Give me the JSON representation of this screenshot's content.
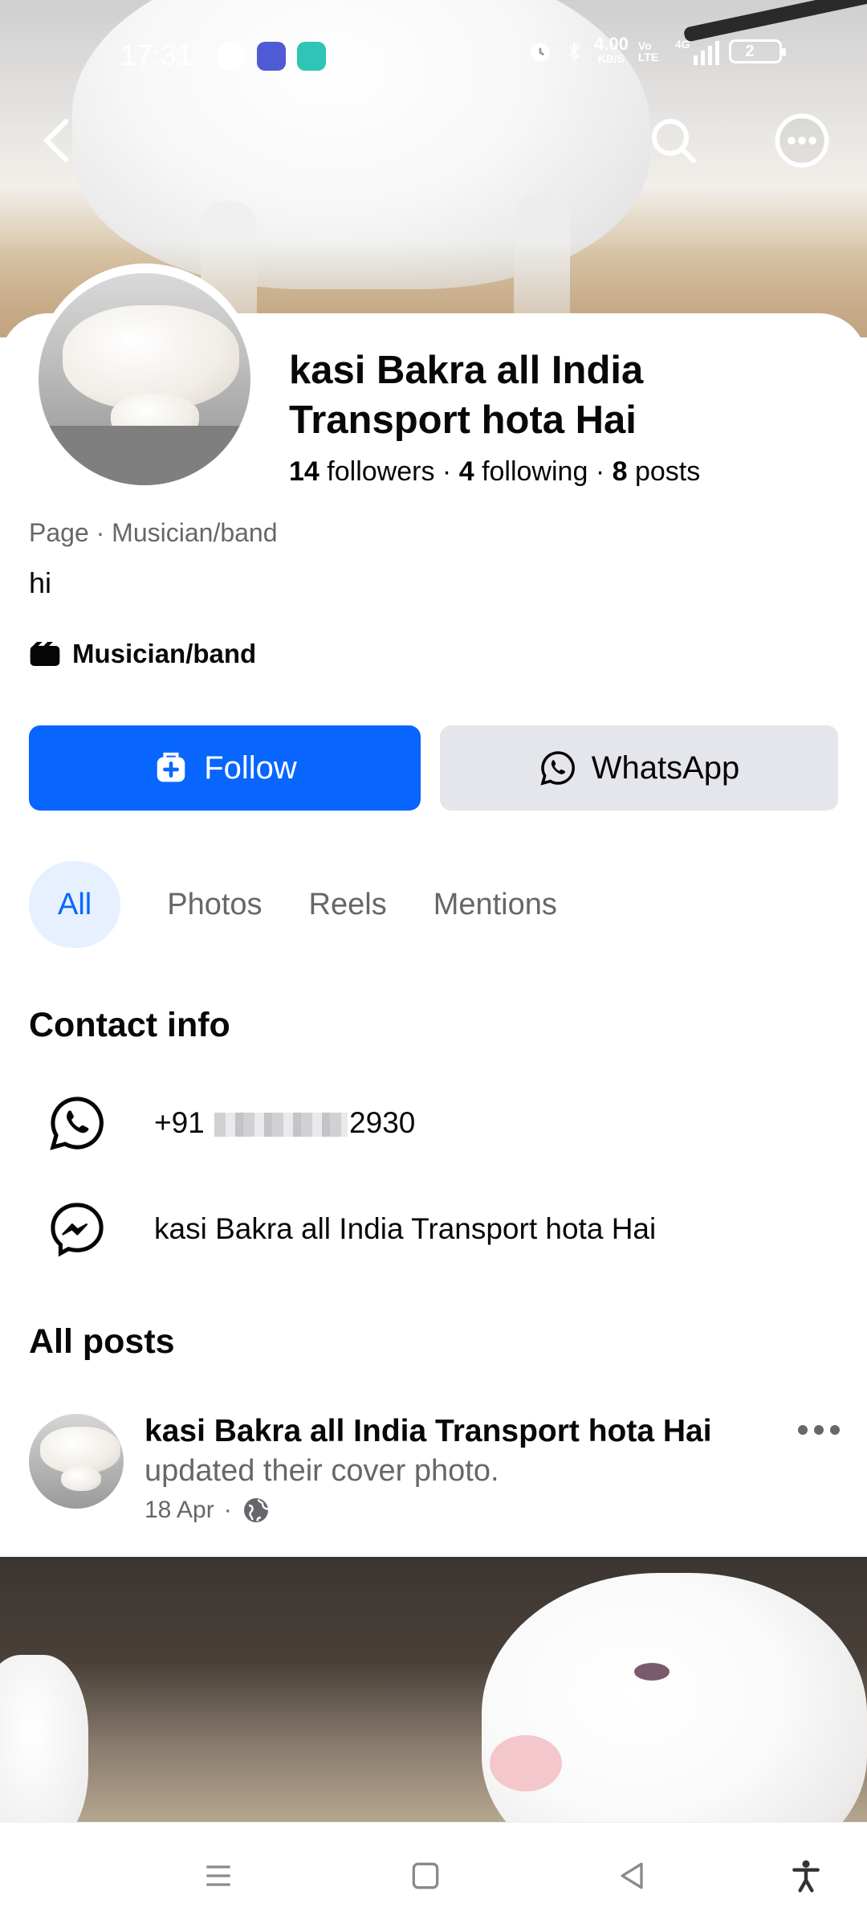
{
  "status_bar": {
    "time": "17:31",
    "network_speed": "4.00",
    "network_unit": "KB/S",
    "volte": "Vo LTE",
    "signal": "4G",
    "battery": "2"
  },
  "profile": {
    "name": "kasi Bakra all India Transport hota Hai",
    "followers_count": "14",
    "followers_label": "followers",
    "following_count": "4",
    "following_label": "following",
    "posts_count": "8",
    "posts_label": "posts",
    "page_category_line": "Page · Musician/band",
    "bio": "hi",
    "category": "Musician/band"
  },
  "actions": {
    "follow_label": "Follow",
    "whatsapp_label": "WhatsApp"
  },
  "tabs": [
    {
      "label": "All"
    },
    {
      "label": "Photos"
    },
    {
      "label": "Reels"
    },
    {
      "label": "Mentions"
    }
  ],
  "contact": {
    "heading": "Contact info",
    "phone_prefix": "+91",
    "phone_suffix": "2930",
    "messenger": "kasi Bakra all India Transport hota Hai"
  },
  "posts": {
    "heading": "All posts",
    "items": [
      {
        "author": "kasi Bakra all India Transport hota Hai",
        "action": "updated their cover photo.",
        "date": "18 Apr",
        "separator": "·"
      }
    ]
  },
  "colors": {
    "accent": "#0866ff",
    "secondary_button": "#e4e6eb",
    "muted_text": "#65676b",
    "active_tab_bg": "#e7f0ff"
  },
  "icons": {
    "back": "chevron-left-icon",
    "search": "search-icon",
    "more": "more-circle-icon",
    "follow": "follow-plus-icon",
    "whatsapp": "whatsapp-icon",
    "messenger": "messenger-icon",
    "category": "clapperboard-icon",
    "globe": "globe-icon"
  }
}
